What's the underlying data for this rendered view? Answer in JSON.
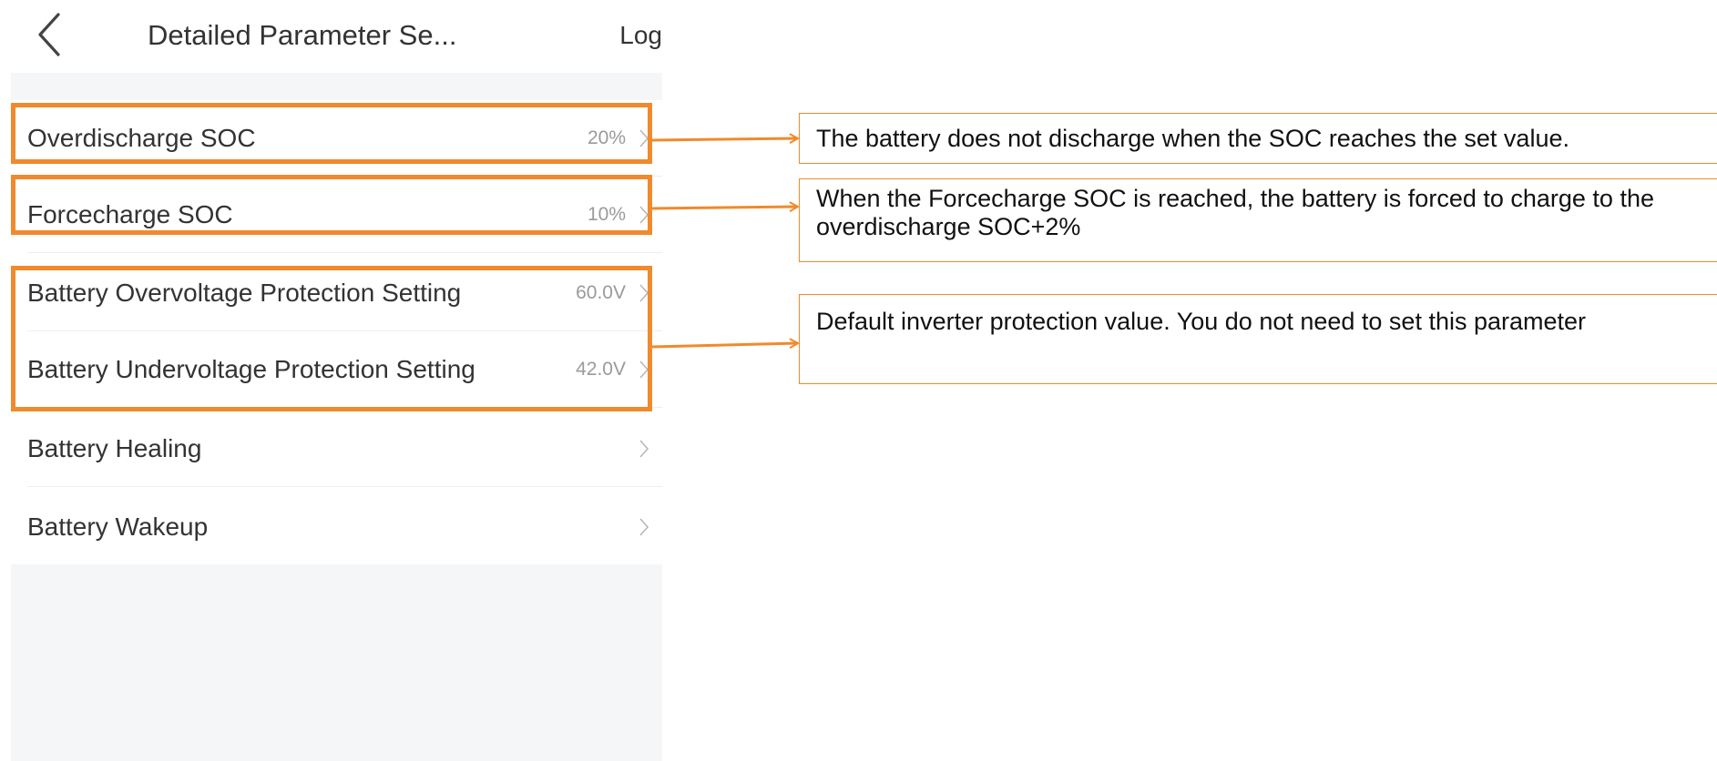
{
  "header": {
    "title": "Detailed Parameter Se...",
    "log_label": "Log"
  },
  "settings": [
    {
      "label": "Overdischarge SOC",
      "value": "20%"
    },
    {
      "label": "Forcecharge SOC",
      "value": "10%"
    },
    {
      "label": "Battery Overvoltage Protection Setting",
      "value": "60.0V"
    },
    {
      "label": "Battery Undervoltage Protection Setting",
      "value": "42.0V"
    },
    {
      "label": "Battery Healing",
      "value": ""
    },
    {
      "label": "Battery Wakeup",
      "value": ""
    }
  ],
  "callouts": [
    {
      "text": "The battery does not discharge when the SOC reaches the set value."
    },
    {
      "text": "When the Forcecharge SOC is reached, the battery is forced to charge to the overdischarge SOC+2%"
    },
    {
      "text": "Default inverter protection value. You do not need to set this parameter"
    }
  ],
  "colors": {
    "highlight": "#f08a2c",
    "text": "#333333",
    "muted": "#9a9a9a",
    "background": "#f5f6f8"
  },
  "icons": {
    "back": "chevron-left-icon",
    "row": "chevron-right-icon"
  }
}
